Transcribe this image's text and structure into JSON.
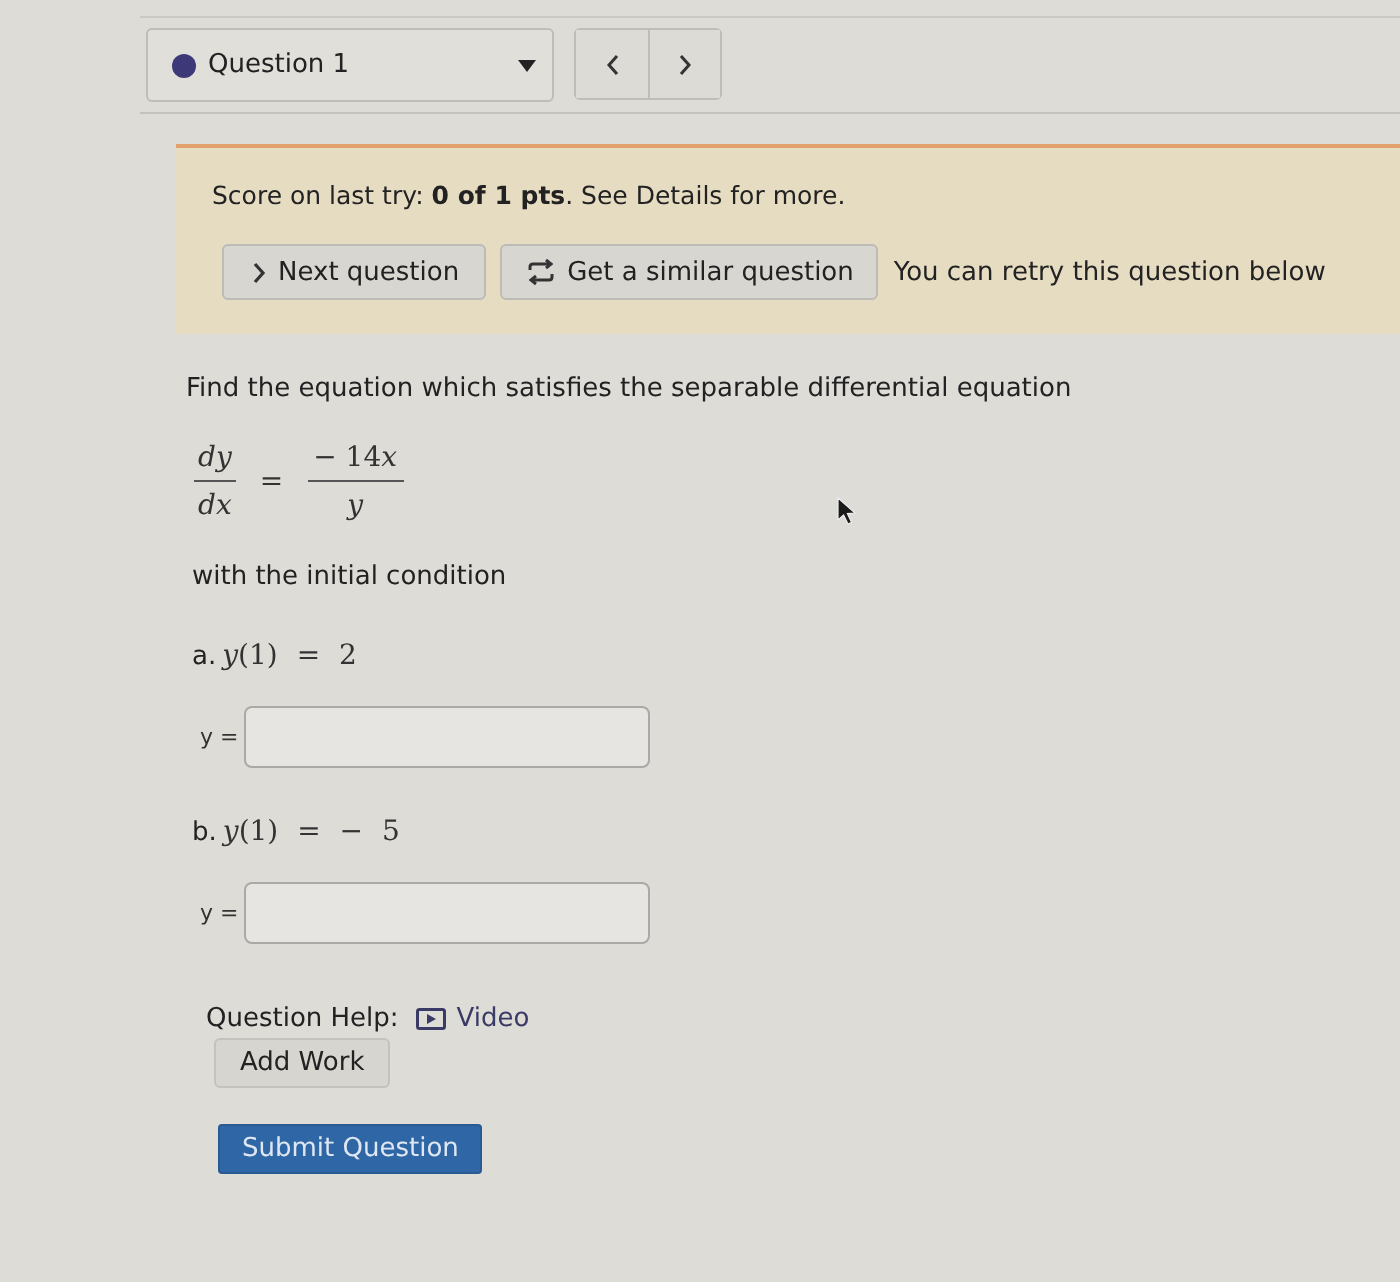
{
  "question_nav": {
    "title": "Question 1"
  },
  "score_panel": {
    "text": "Score on last try: **0 of 1 pts**. See Details for more.",
    "buttons": [
      {
        "label": "Next question",
        "kind": "next"
      },
      {
        "label": "Get a similar question",
        "kind": "similar"
      }
    ],
    "note": "You can retry this question below"
  },
  "question": {
    "prompt": "Find the equation which satisfies the separable differential equation",
    "equation": {
      "lhs_numerator": "dy",
      "lhs_denominator": "dx",
      "relation": "=",
      "rhs_numerator_coefficient": "− 14",
      "rhs_numerator_variable": "x",
      "rhs_denominator": "y"
    },
    "condition_text": "with the initial condition",
    "parts": [
      {
        "label": "a.",
        "condition": "*y*(1) = 2",
        "answer_label": "y ="
      },
      {
        "label": "b.",
        "condition": "*y*(1) = − 5",
        "answer_label": "y ="
      }
    ]
  },
  "help": {
    "label": "Question Help:",
    "link": "Video"
  },
  "actions": {
    "add_work": "Add Work",
    "submit": "Submit Question"
  }
}
